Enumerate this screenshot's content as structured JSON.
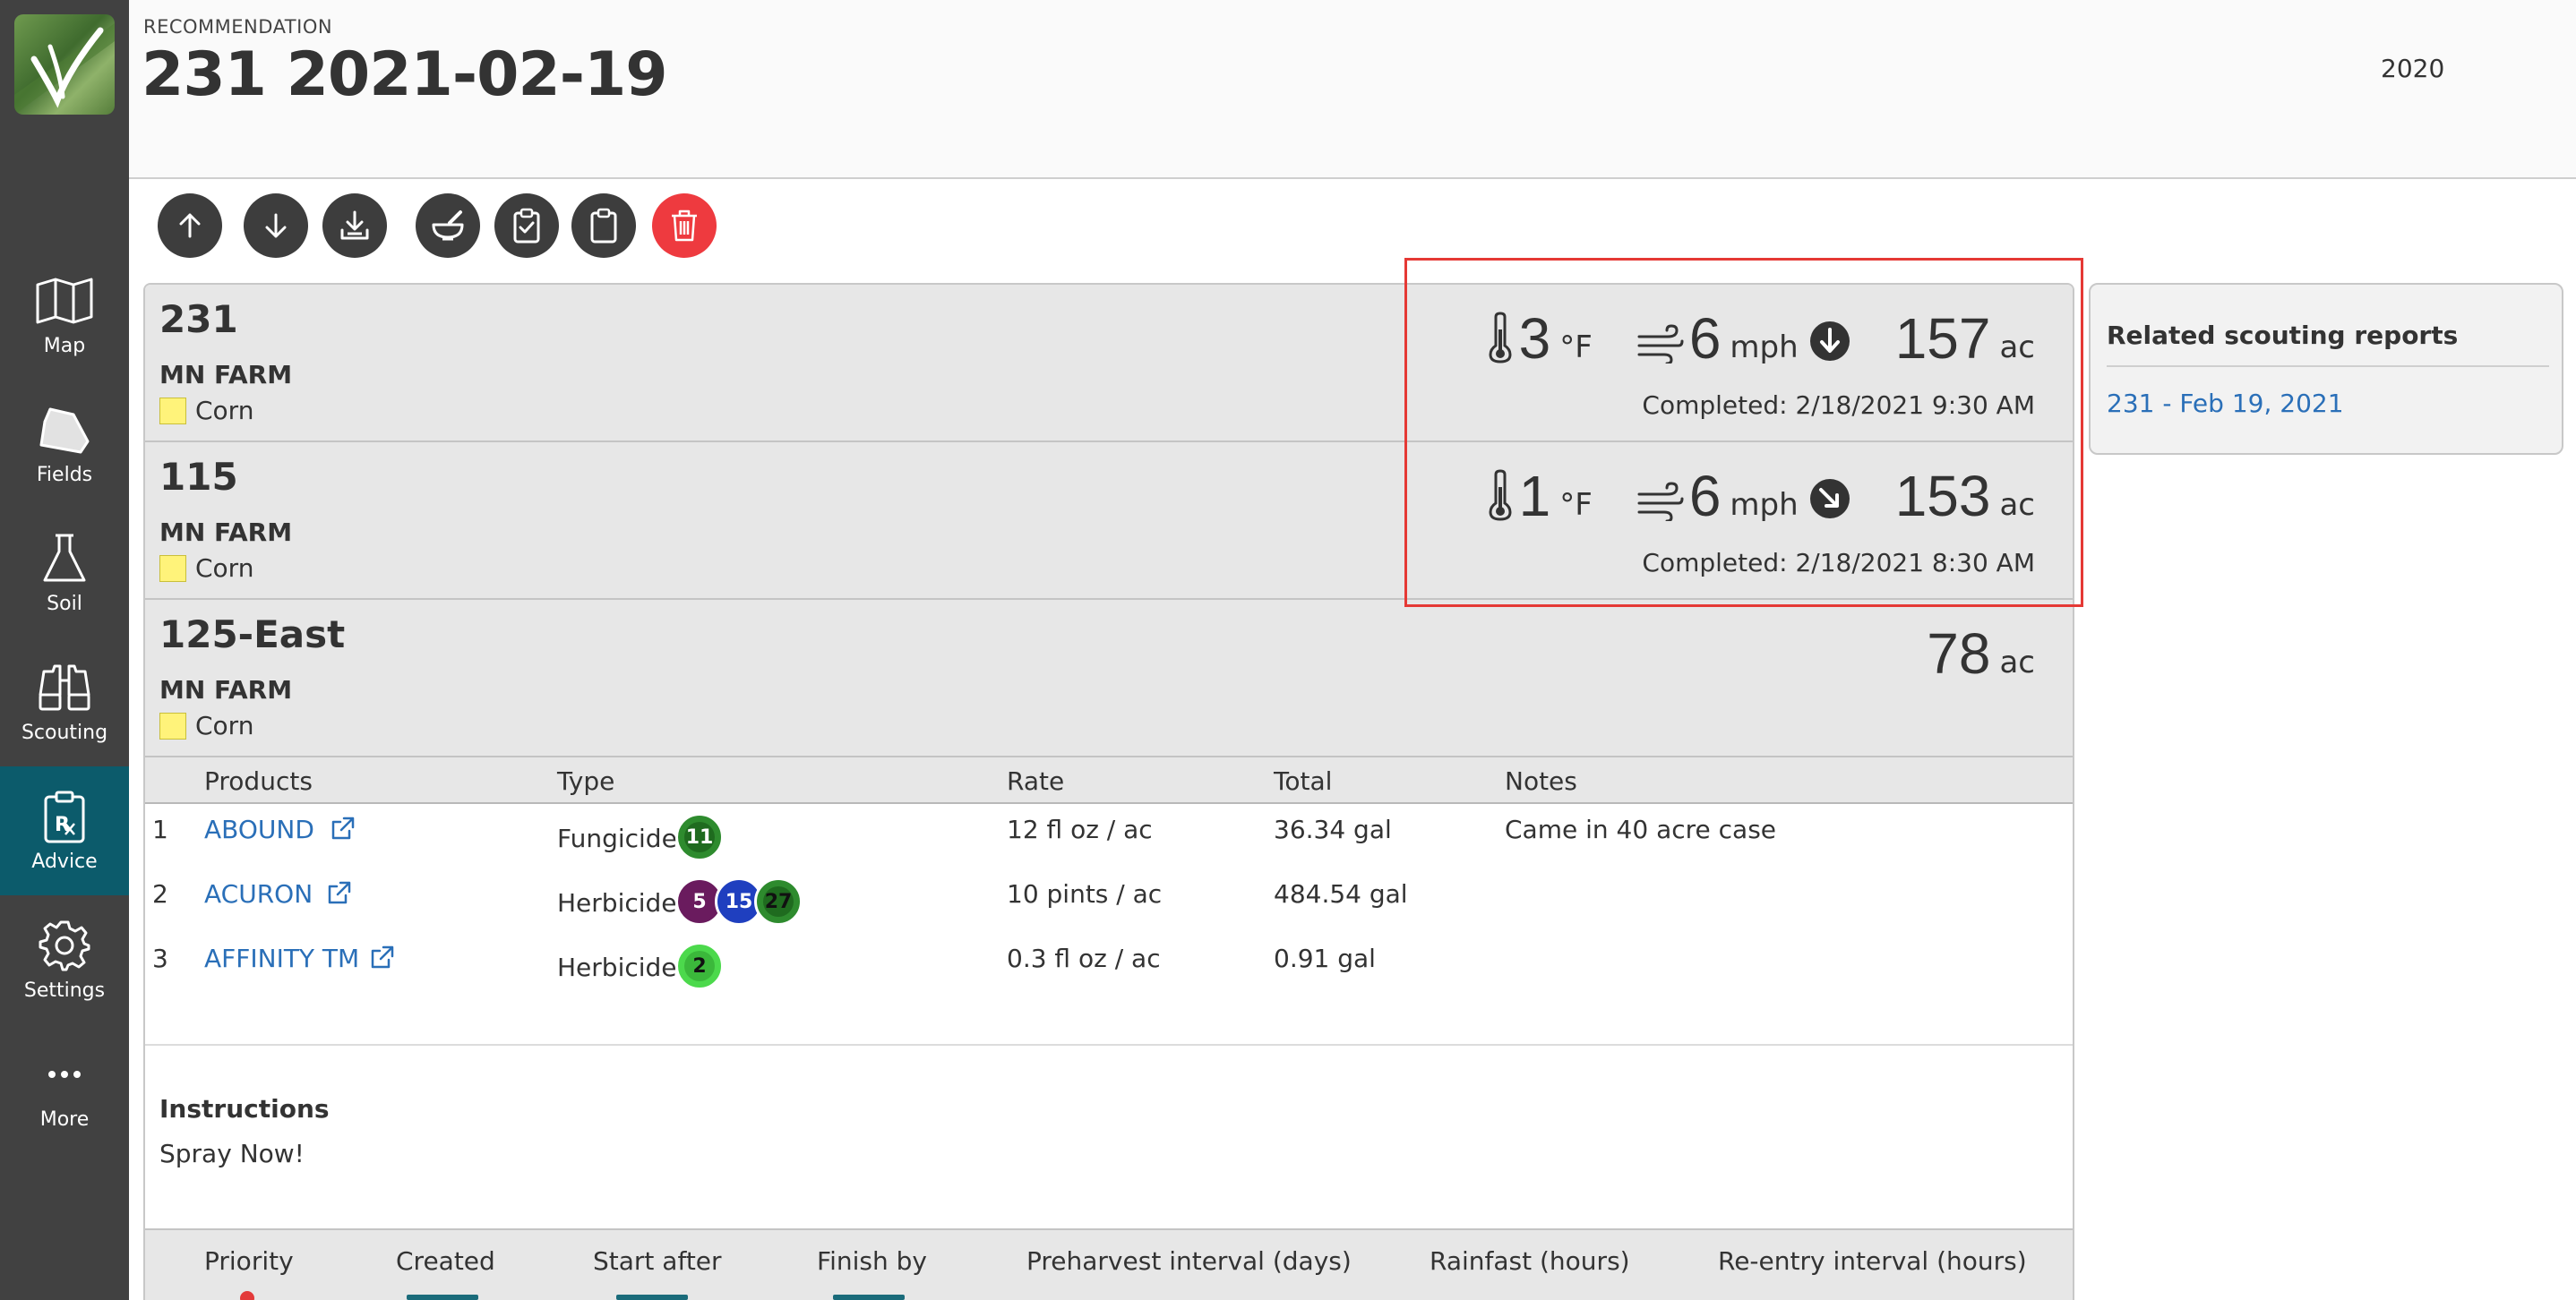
{
  "sidebar": {
    "items": [
      {
        "label": "Map",
        "icon": "map-icon"
      },
      {
        "label": "Fields",
        "icon": "field-icon"
      },
      {
        "label": "Soil",
        "icon": "flask-icon"
      },
      {
        "label": "Scouting",
        "icon": "binoculars-icon"
      },
      {
        "label": "Advice",
        "icon": "rx-clipboard-icon",
        "active": true
      },
      {
        "label": "Settings",
        "icon": "gear-icon"
      },
      {
        "label": "More",
        "icon": "more-dots-icon"
      }
    ]
  },
  "header": {
    "label": "RECOMMENDATION",
    "title": "231 2021-02-19",
    "year": "2020"
  },
  "toolbar": {
    "buttons": [
      "move-up",
      "move-down",
      "download",
      "mortar-pestle",
      "clipboard-check",
      "clipboard",
      "delete"
    ]
  },
  "fields": [
    {
      "name": "231",
      "farm": "MN FARM",
      "crop": "Corn",
      "temp": "3",
      "temp_unit": "°F",
      "wind": "6",
      "wind_unit": "mph",
      "wind_direction": "south",
      "acres": "157",
      "acres_unit": "ac",
      "completed": "Completed: 2/18/2021 9:30 AM"
    },
    {
      "name": "115",
      "farm": "MN FARM",
      "crop": "Corn",
      "temp": "1",
      "temp_unit": "°F",
      "wind": "6",
      "wind_unit": "mph",
      "wind_direction": "southeast",
      "acres": "153",
      "acres_unit": "ac",
      "completed": "Completed: 2/18/2021 8:30 AM"
    },
    {
      "name": "125-East",
      "farm": "MN FARM",
      "crop": "Corn",
      "acres": "78",
      "acres_unit": "ac"
    }
  ],
  "products": {
    "headers": {
      "products": "Products",
      "type": "Type",
      "rate": "Rate",
      "total": "Total",
      "notes": "Notes"
    },
    "rows": [
      {
        "num": "1",
        "name": "ABOUND",
        "type": "Fungicide",
        "badges": [
          {
            "text": "11",
            "bg": "#2e8b2e"
          }
        ],
        "rate": "12 fl oz / ac",
        "total": "36.34 gal",
        "notes": "Came in 40 acre case"
      },
      {
        "num": "2",
        "name": "ACURON",
        "type": "Herbicide",
        "badges": [
          {
            "text": "5",
            "bg": "#6a1b5e"
          },
          {
            "text": "15",
            "bg": "#1f3fbf"
          },
          {
            "text": "27",
            "bg": "#2e8b2e"
          }
        ],
        "rate": "10 pints / ac",
        "total": "484.54 gal",
        "notes": ""
      },
      {
        "num": "3",
        "name": "AFFINITY TM",
        "type": "Herbicide",
        "badges": [
          {
            "text": "2",
            "bg": "#4cd94c"
          }
        ],
        "rate": "0.3 fl oz / ac",
        "total": "0.91 gal",
        "notes": ""
      }
    ]
  },
  "instructions": {
    "label": "Instructions",
    "text": "Spray Now!"
  },
  "bottom": {
    "columns": [
      "Priority",
      "Created",
      "Start after",
      "Finish by",
      "Preharvest interval (days)",
      "Rainfast (hours)",
      "Re-entry interval (hours)"
    ]
  },
  "related": {
    "title": "Related scouting reports",
    "link": "231 - Feb 19, 2021"
  },
  "colors": {
    "sidebar": "#414141",
    "active": "#0c5b6b",
    "link": "#2a6fb8",
    "delete": "#ee3a3f",
    "highlight": "#e53935",
    "crop_swatch": "#fff37a"
  }
}
